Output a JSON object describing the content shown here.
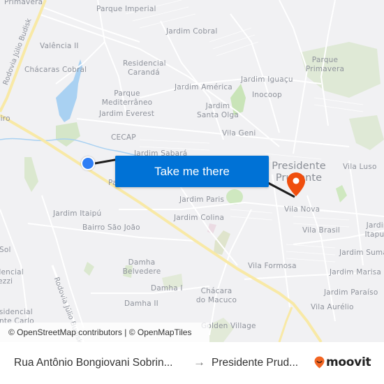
{
  "map": {
    "places": [
      {
        "name": "Primavera",
        "kind": "district"
      },
      {
        "name": "Parque Imperial",
        "kind": "district"
      },
      {
        "name": "Jardim Cobral",
        "kind": "district"
      },
      {
        "name": "Valência II",
        "kind": "district"
      },
      {
        "name": "Residencial Carandá",
        "kind": "district"
      },
      {
        "name": "Chácaras Cobral",
        "kind": "district"
      },
      {
        "name": "Parque Primavera",
        "kind": "district"
      },
      {
        "name": "Jardim Iguaçu",
        "kind": "district"
      },
      {
        "name": "Jardim América",
        "kind": "district"
      },
      {
        "name": "Inocoop",
        "kind": "district"
      },
      {
        "name": "Parque Mediterrâneo",
        "kind": "district"
      },
      {
        "name": "Jardim Santa Olga",
        "kind": "district"
      },
      {
        "name": "Jardim Everest",
        "kind": "district"
      },
      {
        "name": "Vila Geni",
        "kind": "district"
      },
      {
        "name": "CECAP",
        "kind": "district"
      },
      {
        "name": "Jardim Sabará",
        "kind": "district"
      },
      {
        "name": "Presidente Prudente",
        "kind": "city"
      },
      {
        "name": "Vila Luso",
        "kind": "district"
      },
      {
        "name": "Jardim Paris",
        "kind": "district"
      },
      {
        "name": "Vila Nova",
        "kind": "district"
      },
      {
        "name": "Jardim Itaipú",
        "kind": "district"
      },
      {
        "name": "Jardim Colina",
        "kind": "district"
      },
      {
        "name": "Vila Brasil",
        "kind": "district"
      },
      {
        "name": "Jardim Itapura",
        "kind": "district"
      },
      {
        "name": "Bairro São João",
        "kind": "district"
      },
      {
        "name": "Jardim Sumaré",
        "kind": "district"
      },
      {
        "name": "Sol",
        "kind": "district"
      },
      {
        "name": "Damha Belvedere",
        "kind": "district"
      },
      {
        "name": "Vila Formosa",
        "kind": "district"
      },
      {
        "name": "Jardim Marisa",
        "kind": "district"
      },
      {
        "name": "Residencial Tiezzi",
        "kind": "district"
      },
      {
        "name": "Damha I",
        "kind": "district"
      },
      {
        "name": "Chácara do Macuco",
        "kind": "district"
      },
      {
        "name": "Jardim Paraíso",
        "kind": "district"
      },
      {
        "name": "Damha II",
        "kind": "district"
      },
      {
        "name": "Vila Aurélio",
        "kind": "district"
      },
      {
        "name": "Residencial Monte Carlo",
        "kind": "district"
      },
      {
        "name": "Golden Village",
        "kind": "district"
      },
      {
        "name": "eiro",
        "kind": "district"
      },
      {
        "name": "Pa",
        "kind": "district"
      }
    ],
    "roads": [
      {
        "name": "Rodovia Júlio Budisk"
      },
      {
        "name": "Rodovia Júlio Budisk"
      }
    ],
    "origin_marker": {
      "label": "origin",
      "color": "#2e7ef5"
    },
    "destination_marker": {
      "label": "destination",
      "color": "#f04e0e"
    },
    "cta_button": "Take me there",
    "attribution": "© OpenStreetMap contributors | © OpenMapTiles"
  },
  "footer": {
    "origin": "Rua Antônio Bongiovani Sobrin...",
    "arrow": "→",
    "destination": "Presidente Prud...",
    "brand": "moovit",
    "brand_color": "#f26522"
  }
}
